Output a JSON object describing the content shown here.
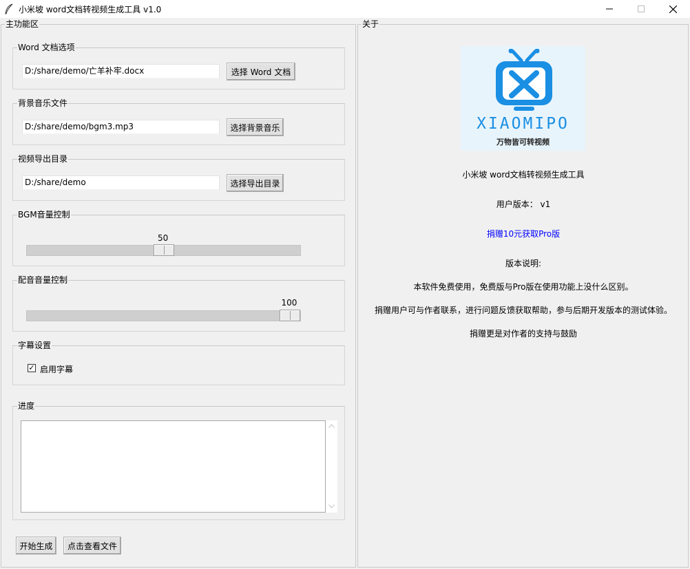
{
  "window": {
    "title": "小米坡 word文档转视频生成工具 v1.0"
  },
  "main_panel": {
    "label": "主功能区",
    "word_group": {
      "label": "Word 文档选项",
      "path": "D:/share/demo/亡羊补牢.docx",
      "button": "选择 Word 文档"
    },
    "bgm_group": {
      "label": "背景音乐文件",
      "path": "D:/share/demo/bgm3.mp3",
      "button": "选择背景音乐"
    },
    "output_group": {
      "label": "视频导出目录",
      "path": "D:/share/demo",
      "button": "选择导出目录"
    },
    "bgm_volume": {
      "label": "BGM音量控制",
      "value": "50",
      "level": 50,
      "max": 100
    },
    "dub_volume": {
      "label": "配音音量控制",
      "value": "100",
      "level": 100,
      "max": 100
    },
    "subtitle_group": {
      "label": "字幕设置",
      "checkbox_label": "启用字幕",
      "checked": true
    },
    "progress_group": {
      "label": "进度",
      "log_text": ""
    },
    "start_button": "开始生成",
    "view_button": "点击查看文件"
  },
  "about_panel": {
    "label": "关于",
    "logo": {
      "brand": "XIAOMIPO",
      "slogan": "万物皆可转视频",
      "icon": "tv-x-icon",
      "accent_color": "#1a8fe3",
      "bg_color": "#e8f4fc"
    },
    "app_name": "小米坡 word文档转视频生成工具",
    "version_line": "用户版本： v1",
    "donate_link": "捐赠10元获取Pro版",
    "link_color": "#0000ff",
    "notes_title": "版本说明:",
    "notes": [
      "本软件免费使用，免费版与Pro版在使用功能上没什么区别。",
      "捐赠用户可与作者联系，进行问题反馈获取帮助，参与后期开发版本的测试体验。",
      "捐赠更是对作者的支持与鼓励"
    ]
  }
}
